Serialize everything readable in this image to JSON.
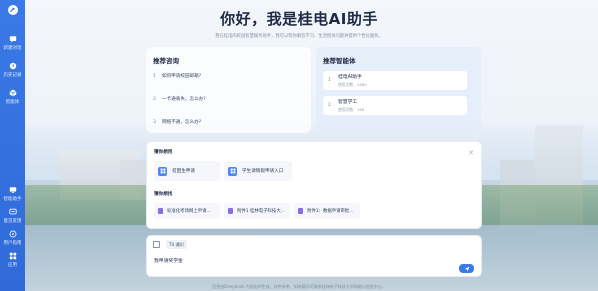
{
  "page": {
    "title": "你好，我是桂电AI助手",
    "subtitle": "我在桂电的校园智慧服务助手，我可以帮你解答学习、生活相关问题并提供个性化服务。"
  },
  "sidebar": {
    "items": [
      {
        "label": "新建对话",
        "icon": "chat-bubble-icon"
      },
      {
        "label": "历史记录",
        "icon": "clock-icon"
      },
      {
        "label": "智能体",
        "icon": "cube-icon"
      },
      {
        "label": "智能助手",
        "icon": "monitor-icon"
      },
      {
        "label": "意见反馈",
        "icon": "feedback-icon"
      },
      {
        "label": "用户指南",
        "icon": "compass-icon"
      },
      {
        "label": "应用",
        "icon": "grid-icon"
      }
    ]
  },
  "recommend_questions": {
    "title": "推荐咨询",
    "items": [
      {
        "num": "1",
        "text": "如何申请校园邮箱?"
      },
      {
        "num": "2",
        "text": "一卡通丢失，怎么办?"
      },
      {
        "num": "3",
        "text": "网络不通，怎么办?"
      }
    ]
  },
  "recommend_agents": {
    "title": "推荐智能体",
    "items": [
      {
        "num": "1",
        "name": "桂电AI助手",
        "usage": "使用次数：2680"
      },
      {
        "num": "2",
        "name": "智慧学工",
        "usage": "使用次数：168"
      }
    ]
  },
  "guess": {
    "title": "猜你想用",
    "apps": [
      {
        "label": "贫困生申请"
      },
      {
        "label": "学生请销假申请入口"
      }
    ],
    "docs_title": "猜你想找",
    "docs": [
      {
        "label": "标准化考场网上申请..."
      },
      {
        "label": "附件1 桂林电子科技大..."
      },
      {
        "label": "附件1：数据申请审批..."
      }
    ]
  },
  "input": {
    "mode": "T4 通识",
    "value": "我申请奖学金"
  },
  "footer": {
    "text": "回答由DeepSeek 内容由AI生成，仅供参考，如有疑问可联系桂林电子科技大学网络与信息中心。"
  },
  "colors": {
    "accent": "#3a79e6",
    "sidebar": "#2f6ad8",
    "title": "#1f2a44"
  }
}
